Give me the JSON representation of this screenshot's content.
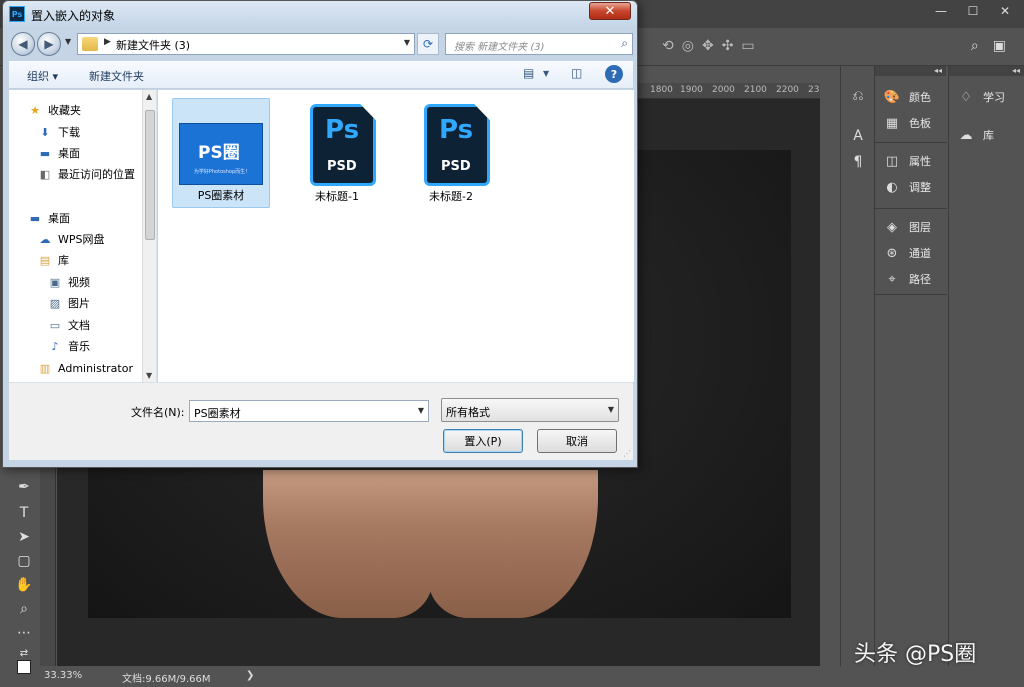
{
  "ps": {
    "ruler_ticks": [
      "1800",
      "1900",
      "2000",
      "2100",
      "2200",
      "23"
    ],
    "dock_a_top": [
      {
        "icon": "palette-icon",
        "glyph": "🎨",
        "label": "颜色"
      },
      {
        "icon": "grid-icon",
        "glyph": "▦",
        "label": "色板"
      }
    ],
    "dock_a_mid": [
      {
        "icon": "properties-icon",
        "glyph": "◫",
        "label": "属性"
      },
      {
        "icon": "adjust-icon",
        "glyph": "◐",
        "label": "调整"
      }
    ],
    "dock_a_bottom": [
      {
        "icon": "layers-icon",
        "glyph": "◈",
        "label": "图层"
      },
      {
        "icon": "channels-icon",
        "glyph": "⊛",
        "label": "通道"
      },
      {
        "icon": "paths-icon",
        "glyph": "⌖",
        "label": "路径"
      }
    ],
    "dock_b": [
      {
        "icon": "bulb-icon",
        "glyph": "♢",
        "label": "学习"
      },
      {
        "icon": "cloud-icon",
        "glyph": "☁",
        "label": "库"
      }
    ],
    "status": {
      "zoom": "33.33%",
      "doc": "文档:9.66M/9.66M",
      "arrow": "❯"
    },
    "watermark": "头条 @PS圈"
  },
  "dialog": {
    "title": "置入嵌入的对象",
    "close_glyph": "✕",
    "address_path": "新建文件夹 (3)",
    "search_placeholder": "搜索 新建文件夹 (3)",
    "toolbar": {
      "organize": "组织 ▾",
      "new_folder": "新建文件夹"
    },
    "nav_items": [
      {
        "icon": "star-icon",
        "glyph": "★",
        "label": "收藏夹",
        "indent": 18,
        "color": "#e8a317"
      },
      {
        "icon": "download-folder-icon",
        "glyph": "⬇",
        "label": "下载",
        "indent": 28,
        "color": "#2d6cb5"
      },
      {
        "icon": "desktop-icon",
        "glyph": "▬",
        "label": "桌面",
        "indent": 28,
        "color": "#2d6cb5"
      },
      {
        "icon": "recent-places-icon",
        "glyph": "◧",
        "label": "最近访问的位置",
        "indent": 28,
        "color": "#6a6a6a"
      },
      {
        "icon": "desktop-icon",
        "glyph": "▬",
        "label": "桌面",
        "indent": 18,
        "color": "#2d6cb5"
      },
      {
        "icon": "wps-cloud-icon",
        "glyph": "☁",
        "label": "WPS网盘",
        "indent": 28,
        "color": "#2d6cb5"
      },
      {
        "icon": "library-icon",
        "glyph": "▤",
        "label": "库",
        "indent": 28,
        "color": "#d8a240"
      },
      {
        "icon": "video-icon",
        "glyph": "▣",
        "label": "视频",
        "indent": 38,
        "color": "#4a6a8a"
      },
      {
        "icon": "pictures-icon",
        "glyph": "▨",
        "label": "图片",
        "indent": 38,
        "color": "#4a6a8a"
      },
      {
        "icon": "documents-icon",
        "glyph": "▭",
        "label": "文档",
        "indent": 38,
        "color": "#4a6a8a"
      },
      {
        "icon": "music-icon",
        "glyph": "♪",
        "label": "音乐",
        "indent": 38,
        "color": "#2d6cb5"
      },
      {
        "icon": "user-folder-icon",
        "glyph": "▥",
        "label": "Administrator",
        "indent": 28,
        "color": "#d8a240"
      }
    ],
    "files": [
      {
        "name": "PS圈素材",
        "type": "image",
        "thumb_big": "PS圈",
        "thumb_small": "为学好Photoshop而生！"
      },
      {
        "name": "未标题-1",
        "type": "psd",
        "badge": "Ps",
        "ext": "PSD"
      },
      {
        "name": "未标题-2",
        "type": "psd",
        "badge": "Ps",
        "ext": "PSD"
      }
    ],
    "filename_label": "文件名(N):",
    "filename_value": "PS圈素材",
    "filetype_value": "所有格式",
    "place_button": "置入(P)",
    "cancel_button": "取消"
  }
}
